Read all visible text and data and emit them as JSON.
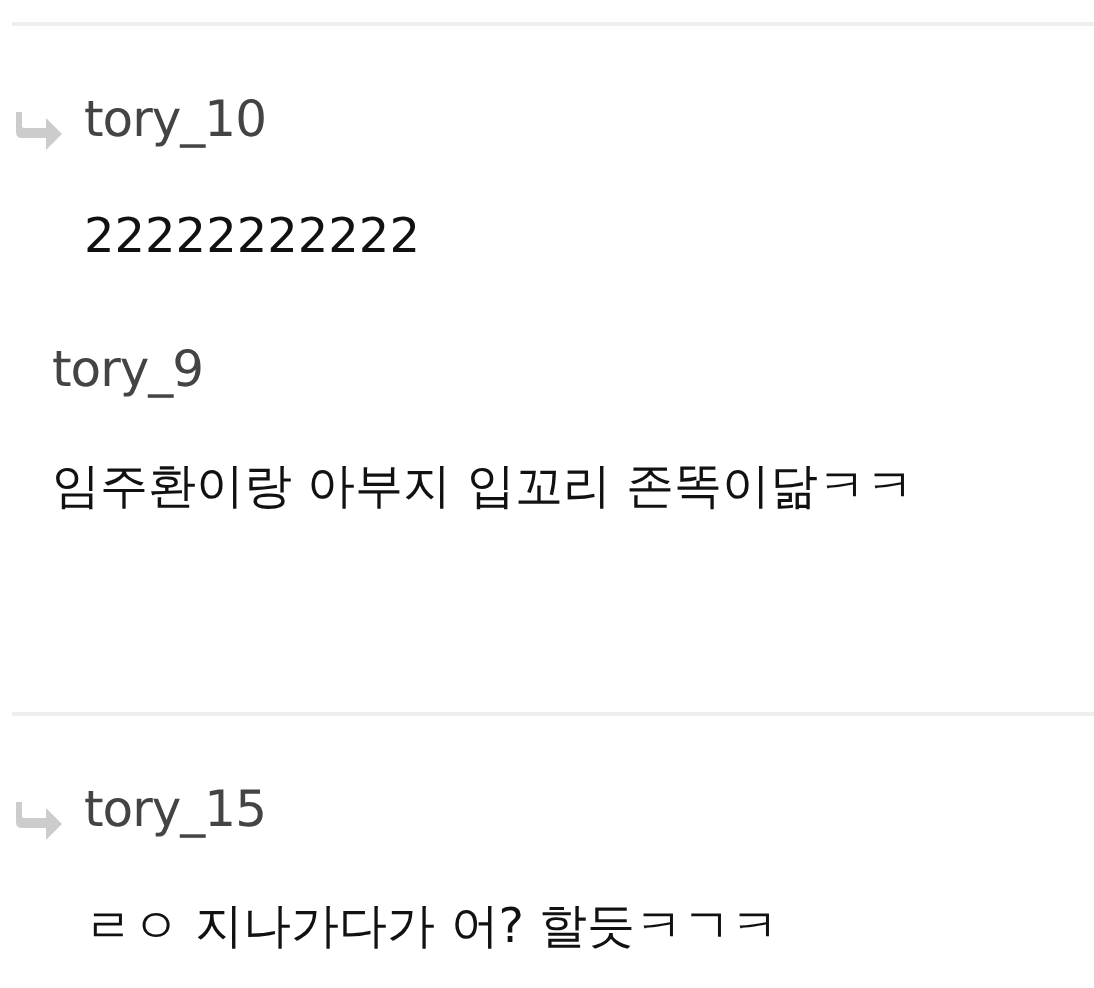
{
  "threads": [
    {
      "comments": [
        {
          "kind": "reply",
          "author": "tory_10",
          "text": "22222222222"
        },
        {
          "kind": "comment",
          "author": "tory_9",
          "text": "임주환이랑 아부지 입꼬리 존똑이닮ㅋㅋ"
        }
      ]
    },
    {
      "comments": [
        {
          "kind": "reply",
          "author": "tory_15",
          "text": "ㄹㅇ 지나가다가 어? 할듯ㅋㄱㅋ"
        }
      ]
    }
  ]
}
